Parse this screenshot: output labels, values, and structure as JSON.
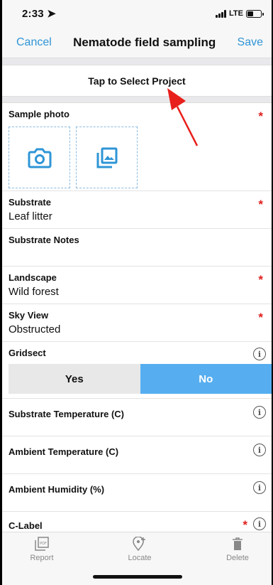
{
  "status": {
    "time": "2:33",
    "network": "LTE"
  },
  "nav": {
    "cancel": "Cancel",
    "title": "Nematode field sampling",
    "save": "Save"
  },
  "project": {
    "label": "Tap to Select Project"
  },
  "fields": {
    "sample_photo": {
      "label": "Sample photo",
      "required": "*"
    },
    "substrate": {
      "label": "Substrate",
      "value": "Leaf litter",
      "required": "*"
    },
    "substrate_notes": {
      "label": "Substrate Notes",
      "value": ""
    },
    "landscape": {
      "label": "Landscape",
      "value": "Wild forest",
      "required": "*"
    },
    "sky_view": {
      "label": "Sky View",
      "value": "Obstructed",
      "required": "*"
    },
    "gridsect": {
      "label": "Gridsect",
      "yes": "Yes",
      "no": "No",
      "selected": "No"
    },
    "substrate_temp": {
      "label": "Substrate Temperature (C)"
    },
    "ambient_temp": {
      "label": "Ambient Temperature (C)"
    },
    "ambient_humidity": {
      "label": "Ambient Humidity (%)"
    },
    "c_label": {
      "label": "C-Label",
      "required": "*"
    }
  },
  "info_glyph": "i",
  "toolbar": {
    "report": "Report",
    "locate": "Locate",
    "delete": "Delete"
  },
  "colors": {
    "accent": "#2f95d6",
    "required": "#e02020",
    "toggle_active": "#56aef0",
    "annotation_arrow": "#e8201c"
  },
  "icons": [
    "camera-icon",
    "gallery-icon",
    "pdf-report-icon",
    "location-pin-add-icon",
    "trash-icon",
    "info-icon"
  ]
}
